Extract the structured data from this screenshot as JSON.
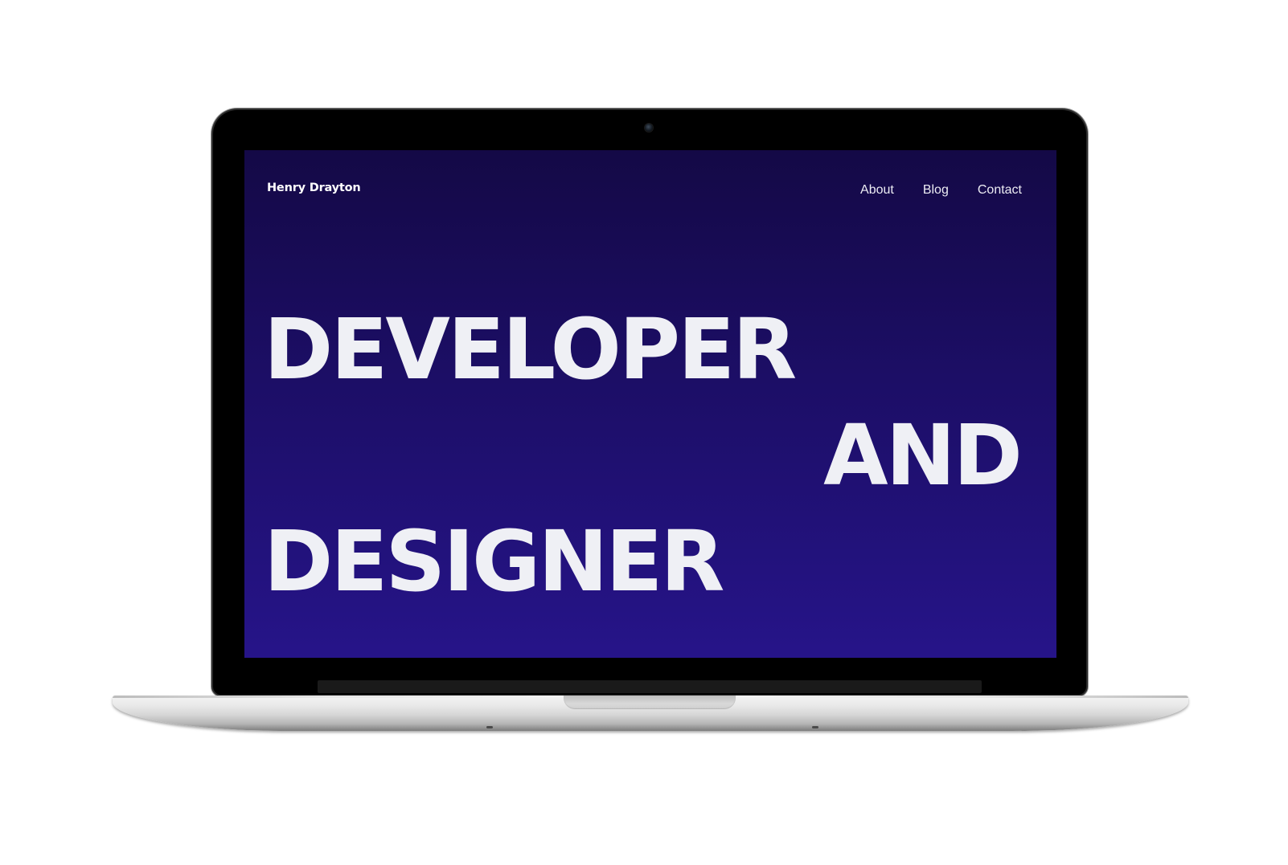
{
  "site": {
    "logo": "Henry Drayton",
    "nav": [
      {
        "label": "About"
      },
      {
        "label": "Blog"
      },
      {
        "label": "Contact"
      }
    ]
  },
  "hero": {
    "line1": "DEVELOPER",
    "line2": "AND",
    "line3": "DESIGNER"
  },
  "colors": {
    "screen_top": "#140946",
    "screen_bottom": "#261489",
    "hero_text": "#eff0f5",
    "page_background": "#ffffff"
  }
}
